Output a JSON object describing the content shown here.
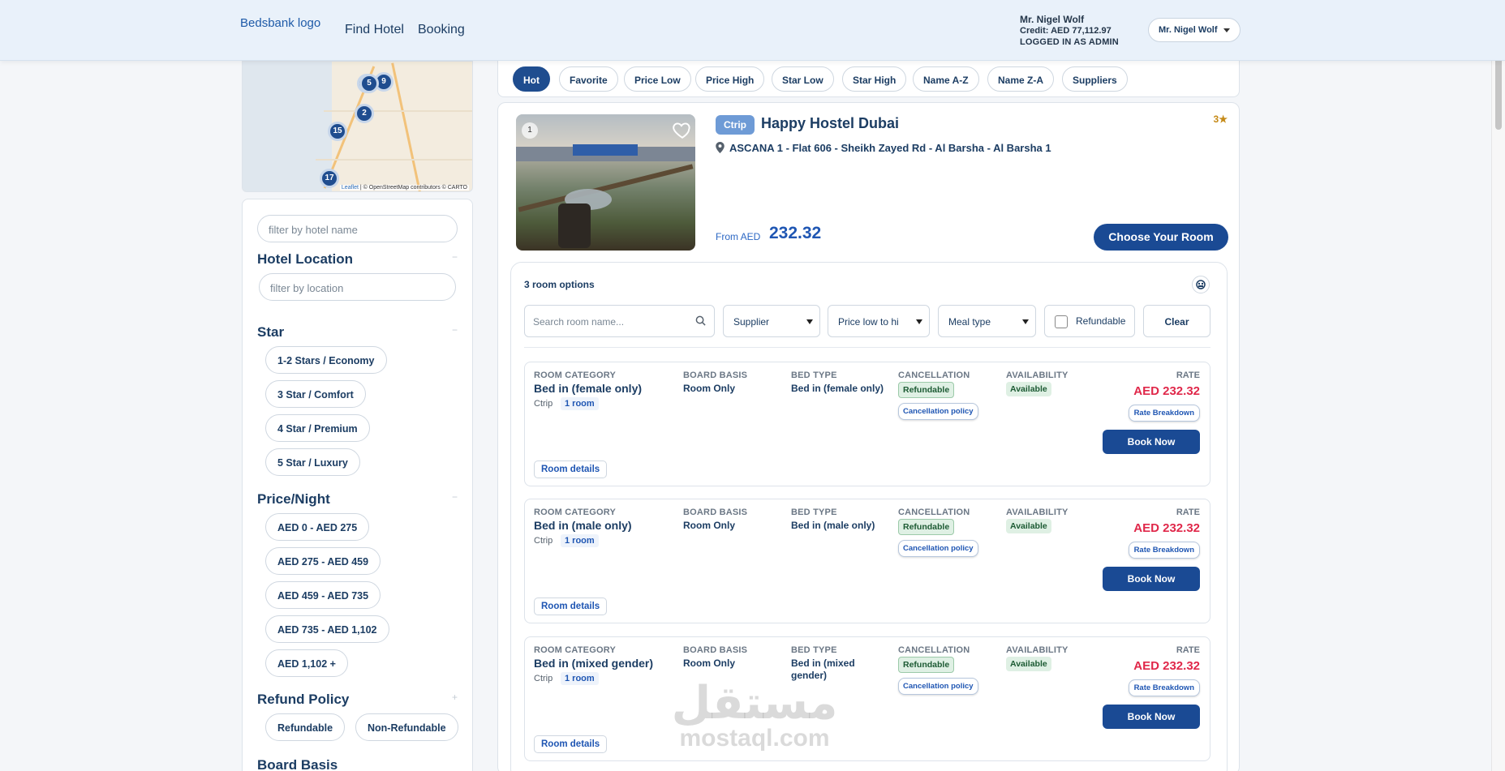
{
  "header": {
    "logo": "Bedsbank logo",
    "nav": [
      "Find Hotel",
      "Booking"
    ],
    "user_name": "Mr. Nigel Wolf",
    "credit": "Credit: AED 77,112.97",
    "role": "LOGGED IN AS ADMIN",
    "user_menu": "Mr. Nigel Wolf"
  },
  "map": {
    "clusters": [
      "5",
      "9",
      "2",
      "15",
      "17"
    ],
    "attribution_link": "Leaflet",
    "attribution_text": "| © OpenStreetMap contributors © CARTO"
  },
  "filters": {
    "hotel_name_placeholder": "filter by hotel name",
    "location_title": "Hotel Location",
    "location_placeholder": "filter by location",
    "star_title": "Star",
    "stars": [
      "1-2 Stars / Economy",
      "3 Star / Comfort",
      "4 Star / Premium",
      "5 Star / Luxury"
    ],
    "price_title": "Price/Night",
    "prices": [
      "AED 0 - AED 275",
      "AED 275 - AED 459",
      "AED 459 - AED 735",
      "AED 735 - AED 1,102",
      "AED 1,102 +"
    ],
    "refund_title": "Refund Policy",
    "refund_options": [
      "Refundable",
      "Non-Refundable"
    ],
    "board_title": "Board Basis",
    "collapse_symbol": "−",
    "expand_symbol": "+"
  },
  "sort": {
    "options": [
      "Hot",
      "Favorite",
      "Price Low",
      "Price High",
      "Star Low",
      "Star High",
      "Name A-Z",
      "Name Z-A",
      "Suppliers"
    ],
    "active": "Hot"
  },
  "hotel": {
    "supplier_tag": "Ctrip",
    "name": "Happy Hostel Dubai",
    "stars": "3",
    "address": "ASCANA 1 - Flat 606 - Sheikh Zayed Rd - Al Barsha - Al Barsha 1",
    "image_index": "1",
    "from_label": "From AED",
    "from_price": "232.32",
    "choose_button": "Choose Your Room"
  },
  "rooms": {
    "count_label": "3 room options",
    "search_placeholder": "Search room name...",
    "supplier_select": "Supplier",
    "price_select": "Price low to hi",
    "meal_select": "Meal type",
    "refundable_label": "Refundable",
    "clear_label": "Clear",
    "headers": {
      "category": "ROOM CATEGORY",
      "board": "BOARD BASIS",
      "bed": "BED TYPE",
      "cancellation": "CANCELLATION",
      "availability": "AVAILABILITY",
      "rate": "RATE"
    },
    "list": [
      {
        "name": "Bed in (female only)",
        "supplier": "Ctrip",
        "qty": "1 room",
        "board": "Room Only",
        "bed": "Bed in (female only)",
        "cancellation": "Refundable",
        "policy": "Cancellation policy",
        "availability": "Available",
        "rate": "AED 232.32",
        "breakdown": "Rate Breakdown",
        "book": "Book Now",
        "details": "Room details"
      },
      {
        "name": "Bed in (male only)",
        "supplier": "Ctrip",
        "qty": "1 room",
        "board": "Room Only",
        "bed": "Bed in (male only)",
        "cancellation": "Refundable",
        "policy": "Cancellation policy",
        "availability": "Available",
        "rate": "AED 232.32",
        "breakdown": "Rate Breakdown",
        "book": "Book Now",
        "details": "Room details"
      },
      {
        "name": "Bed in (mixed gender)",
        "supplier": "Ctrip",
        "qty": "1 room",
        "board": "Room Only",
        "bed": "Bed in (mixed gender)",
        "cancellation": "Refundable",
        "policy": "Cancellation policy",
        "availability": "Available",
        "rate": "AED 232.32",
        "breakdown": "Rate Breakdown",
        "book": "Book Now",
        "details": "Room details"
      }
    ]
  },
  "watermark": {
    "arabic": "مستقل",
    "latin": "mostaql.com"
  },
  "colors": {
    "primary": "#1a4a94",
    "rate_red": "#e0284a",
    "header_bg": "#e9f1fa",
    "star_gold": "#c58a17"
  }
}
